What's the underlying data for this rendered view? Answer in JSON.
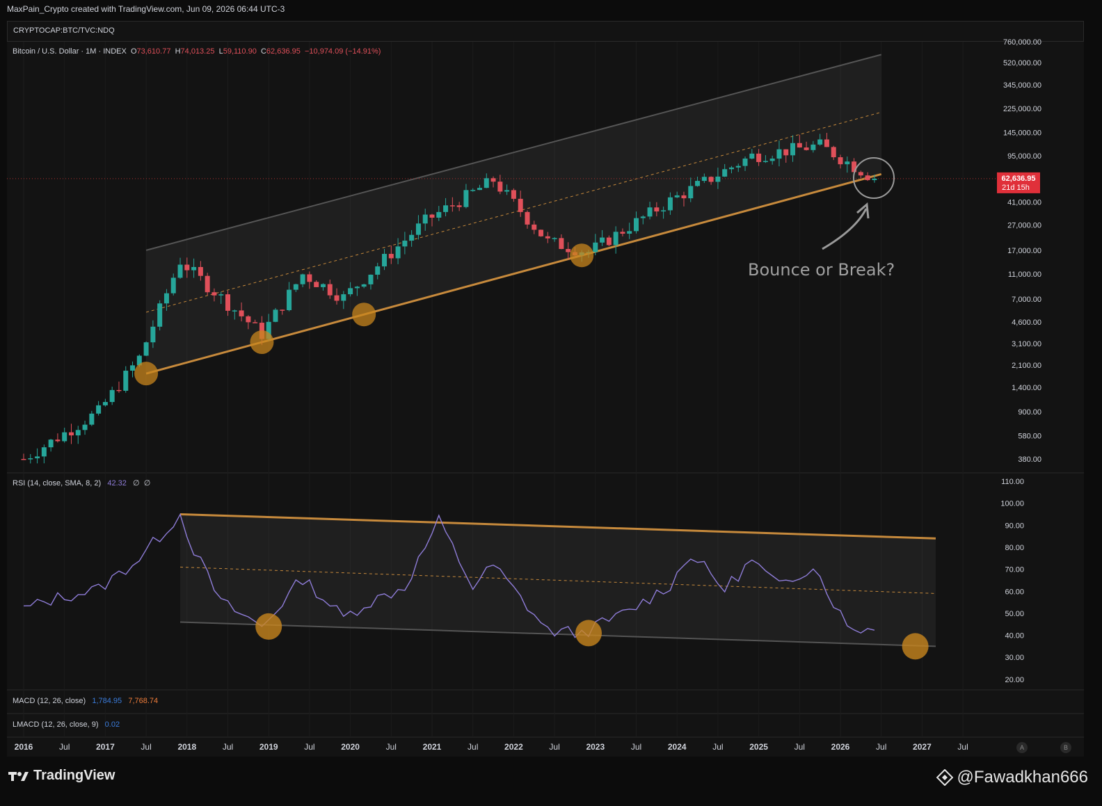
{
  "header": {
    "creator_line": "MaxPain_Crypto created with TradingView.com, Jun 09, 2026 06:44 UTC-3",
    "symbol": "CRYPTOCAP:BTC/TVC:NDQ"
  },
  "price_legend": {
    "name": "Bitcoin / U.S. Dollar · 1M · INDEX",
    "o_label": "O",
    "o_value": "73,610.77",
    "h_label": "H",
    "h_value": "74,013.25",
    "l_label": "L",
    "l_value": "59,110.90",
    "c_label": "C",
    "c_value": "62,636.95",
    "change": "−10,974.09 (−14.91%)"
  },
  "price_axis_ticks": [
    "760,000.00",
    "520,000.00",
    "345,000.00",
    "225,000.00",
    "145,000.00",
    "95,000.00",
    "62,636.95",
    "41,000.00",
    "27,000.00",
    "17,000.00",
    "11,000.00",
    "7,000.00",
    "4,600.00",
    "3,100.00",
    "2,100.00",
    "1,400.00",
    "900.00",
    "580.00",
    "380.00"
  ],
  "last_price_badge": {
    "price": "62,636.95",
    "countdown": "21d 15h",
    "color": "#e0303a"
  },
  "annotation": {
    "text": "Bounce or Break?"
  },
  "rsi_legend": {
    "name": "RSI (14, close, SMA, 8, 2)",
    "value": "42.32",
    "extra1": "∅",
    "extra2": "∅"
  },
  "rsi_axis_ticks": [
    "110.00",
    "100.00",
    "90.00",
    "80.00",
    "70.00",
    "60.00",
    "50.00",
    "40.00",
    "30.00",
    "20.00"
  ],
  "macd_legend": {
    "name": "MACD (12, 26, close)",
    "v1": "1,784.95",
    "v2": "7,768.74"
  },
  "lmacd_legend": {
    "name": "LMACD (12, 26, close, 9)",
    "v1": "0.02"
  },
  "time_axis": [
    "2016",
    "Jul",
    "2017",
    "Jul",
    "2018",
    "Jul",
    "2019",
    "Jul",
    "2020",
    "Jul",
    "2021",
    "Jul",
    "2022",
    "Jul",
    "2023",
    "Jul",
    "2024",
    "Jul",
    "2025",
    "Jul",
    "2026",
    "Jul",
    "2027",
    "Jul"
  ],
  "axis_buttons": [
    "A",
    "B"
  ],
  "footer": {
    "brand": "TradingView",
    "handle": "@Fawadkhan666"
  },
  "colors": {
    "up": "#26a69a",
    "down": "#e0505a",
    "channel_support": "#c78a3c",
    "touch_marker": "#c8861e",
    "rsi_line": "#8f7dd9"
  },
  "chart_data": [
    {
      "type": "candlestick",
      "title": "Bitcoin / U.S. Dollar · 1M · INDEX",
      "scale": "log",
      "x_range": [
        "2016-01",
        "2027-12"
      ],
      "y_range": [
        300,
        760000
      ],
      "annual_trend_closes": {
        "2016-01": 380,
        "2016-12": 900,
        "2017-06": 2400,
        "2017-12": 14000,
        "2018-12": 3700,
        "2019-06": 11000,
        "2019-12": 7200,
        "2020-12": 29000,
        "2021-10": 61000,
        "2022-06": 19900,
        "2022-12": 16500,
        "2023-12": 42000,
        "2024-12": 95000,
        "2025-10": 115000,
        "2026-06": 62636.95
      },
      "channel": {
        "upper": [
          [
            "2017-07",
            17000
          ],
          [
            "2026-07",
            600000
          ]
        ],
        "mid": [
          [
            "2017-07",
            5500
          ],
          [
            "2026-07",
            210000
          ]
        ],
        "lower": [
          [
            "2017-07",
            1800
          ],
          [
            "2026-07",
            68000
          ]
        ]
      },
      "touch_points": [
        "2017-07",
        "2018-12",
        "2020-03",
        "2022-11"
      ],
      "current_price": 62636.95
    },
    {
      "type": "line",
      "title": "RSI (14, close, SMA, 8, 2)",
      "y_range": [
        20,
        110
      ],
      "resistance_line": [
        [
          "2017-12",
          95
        ],
        [
          "2027-03",
          84
        ]
      ],
      "support_line": [
        [
          "2017-12",
          46
        ],
        [
          "2027-03",
          35
        ]
      ],
      "mid_line": [
        [
          "2017-12",
          71
        ],
        [
          "2027-03",
          59
        ]
      ],
      "touch_points": [
        [
          "2019-01",
          44
        ],
        [
          "2022-12",
          41
        ],
        [
          "2026-12",
          35
        ]
      ],
      "current_value": 42.32
    }
  ]
}
